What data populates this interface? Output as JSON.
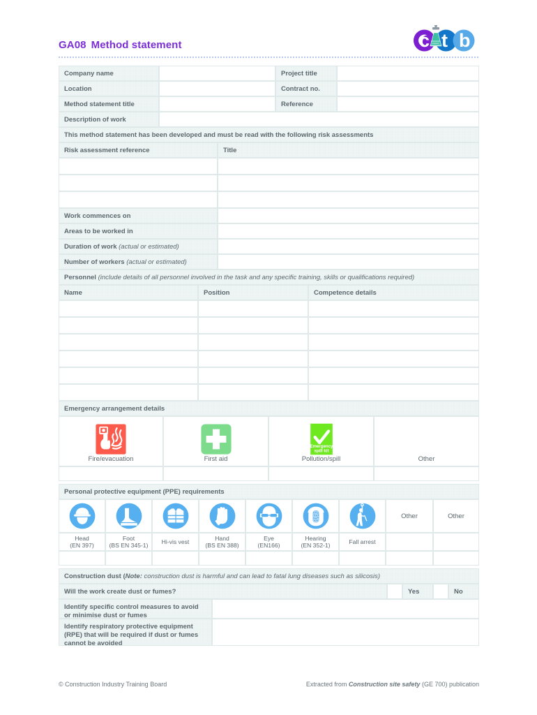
{
  "header": {
    "code": "GA08",
    "title": "Method statement",
    "logo_alt": "citb-logo",
    "logo_colors": {
      "c": "#7b1fd0",
      "i": "#3bbfa3",
      "t": "#1277c8",
      "b": "#58a9e8"
    },
    "title_color": "#7b2fd4"
  },
  "top_table": {
    "rows": [
      {
        "label_left": "Company name",
        "value_left": "",
        "label_right": "Project title",
        "value_right": ""
      },
      {
        "label_left": "Location",
        "value_left": "",
        "label_right": "Contract no.",
        "value_right": ""
      },
      {
        "label_left": "Method statement title",
        "value_left": "",
        "label_right": "Reference",
        "value_right": ""
      }
    ],
    "description_label": "Description of work",
    "description_value": ""
  },
  "risk": {
    "banner": "This method statement has been developed and must be read with the following risk assessments",
    "col_ref": "Risk assessment reference",
    "col_title": "Title",
    "rows": [
      {
        "ref": "",
        "title": ""
      },
      {
        "ref": "",
        "title": ""
      },
      {
        "ref": "",
        "title": ""
      }
    ]
  },
  "details": [
    {
      "label": "Work commences on",
      "note": "",
      "value": ""
    },
    {
      "label": "Areas to be worked in",
      "note": "",
      "value": ""
    },
    {
      "label": "Duration of work",
      "note": "(actual or estimated)",
      "value": ""
    },
    {
      "label": "Number of workers",
      "note": "(actual or estimated)",
      "value": ""
    }
  ],
  "personnel": {
    "banner_bold": "Personnel",
    "banner_note": "(include details of  all personnel involved in the task and any specific training, skills or qualifications required)",
    "columns": [
      "Name",
      "Position",
      "Competence details"
    ],
    "rows": [
      {
        "name": "",
        "position": "",
        "competence": ""
      },
      {
        "name": "",
        "position": "",
        "competence": ""
      },
      {
        "name": "",
        "position": "",
        "competence": ""
      },
      {
        "name": "",
        "position": "",
        "competence": ""
      },
      {
        "name": "",
        "position": "",
        "competence": ""
      },
      {
        "name": "",
        "position": "",
        "competence": ""
      }
    ]
  },
  "emergency": {
    "banner": "Emergency arrangement details",
    "items": [
      {
        "caption": "Fire/evacuation",
        "icon": "fire-evacuation-icon",
        "value": ""
      },
      {
        "caption": "First aid",
        "icon": "first-aid-icon",
        "value": ""
      },
      {
        "caption": "Pollution/spill",
        "icon": "emergency-spill-kit-icon",
        "spill_text_1": "Emergency",
        "spill_text_2": "spill kit",
        "value": ""
      },
      {
        "caption": "Other",
        "icon": "",
        "value": ""
      }
    ]
  },
  "ppe": {
    "banner": "Personal protective equipment (PPE) requirements",
    "items": [
      {
        "icon": "hard-hat-icon",
        "label1": "Head",
        "label2": "(EN 397)",
        "value": ""
      },
      {
        "icon": "safety-boot-icon",
        "label1": "Foot",
        "label2": "(BS EN 345-1)",
        "value": ""
      },
      {
        "icon": "hi-vis-vest-icon",
        "label1": "Hi-vis vest",
        "label2": "",
        "value": ""
      },
      {
        "icon": "safety-gloves-icon",
        "label1": "Hand",
        "label2": "(BS EN 388)",
        "value": ""
      },
      {
        "icon": "safety-goggles-icon",
        "label1": "Eye",
        "label2": "(EN166)",
        "value": ""
      },
      {
        "icon": "ear-defenders-icon",
        "label1": "Hearing",
        "label2": "(EN 352-1)",
        "value": ""
      },
      {
        "icon": "fall-arrest-harness-icon",
        "label1": "Fall arrest",
        "label2": "",
        "value": ""
      },
      {
        "icon": "",
        "label1": "Other",
        "label2": "",
        "value": ""
      },
      {
        "icon": "",
        "label1": "Other",
        "label2": "",
        "value": ""
      }
    ]
  },
  "dust": {
    "banner_bold": "Construction dust (",
    "banner_note_bold": "Note:",
    "banner_note": " construction dust is harmful and can lead to fatal lung diseases such as silicosis)",
    "question": "Will the work create dust or fumes?",
    "yes_label": "Yes",
    "no_label": "No",
    "yes_checked": false,
    "no_checked": false,
    "control_label": "Identify specific control measures to avoid or minimise dust or fumes",
    "control_value": "",
    "rpe_label": "Identify respiratory protective equipment (RPE) that will be required if dust or fumes cannot be avoided",
    "rpe_value": ""
  },
  "footer": {
    "left": "© Construction Industry Training Board",
    "right_pre": "Extracted from ",
    "right_italic": "Construction site safety",
    "right_post": " (GE 700) publication"
  }
}
